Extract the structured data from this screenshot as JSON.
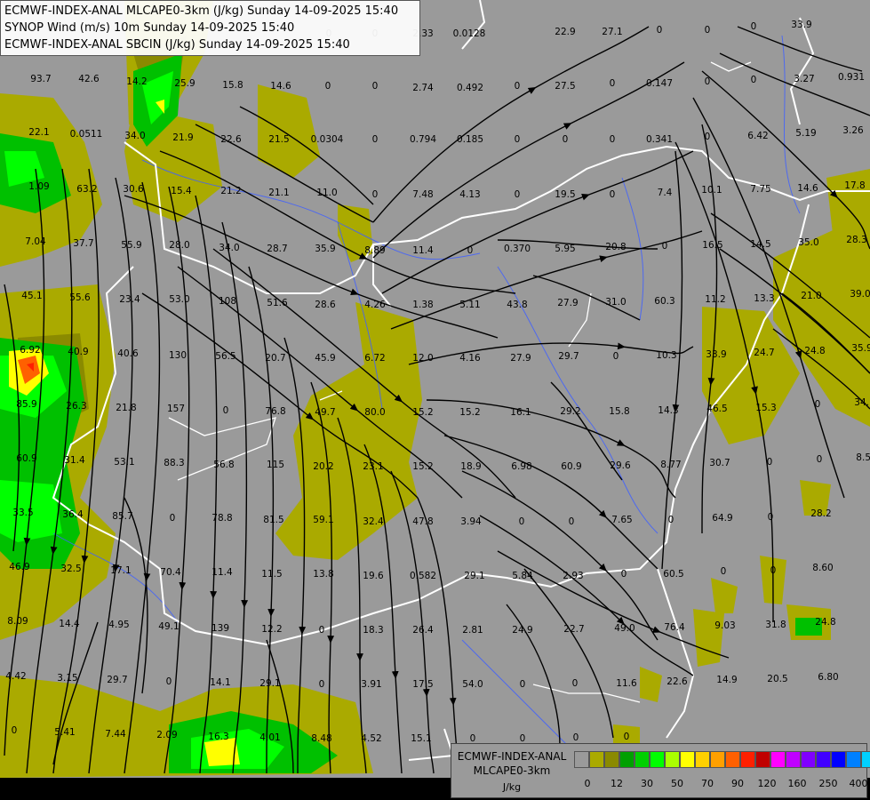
{
  "titles": {
    "line1": "ECMWF-INDEX-ANAL MLCAPE0-3km (J/kg) Sunday 14-09-2025 15:40",
    "line2": "SYNOP Wind (m/s) 10m Sunday 14-09-2025 15:40",
    "line3": "ECMWF-INDEX-ANAL SBCIN (J/kg) Sunday 14-09-2025 15:40"
  },
  "legend": {
    "name_line1": "ECMWF-INDEX-ANAL",
    "name_line2": "MLCAPE0-3km",
    "unit": "J/kg",
    "colors": [
      "#9a9a9a",
      "#aaaa00",
      "#8a8a00",
      "#00a000",
      "#00d000",
      "#00ff00",
      "#aaff00",
      "#ffff00",
      "#ffd000",
      "#ffa000",
      "#ff6000",
      "#ff2000",
      "#c00000",
      "#ff00ff",
      "#c000ff",
      "#8000ff",
      "#4000ff",
      "#0000ff",
      "#0080ff",
      "#00d0ff",
      "#80ffff",
      "#ffffff"
    ],
    "ticks": [
      "0",
      "12",
      "30",
      "50",
      "70",
      "90",
      "120",
      "160",
      "250",
      "400"
    ]
  },
  "values": [
    "0.0128",
    "2.33",
    "0",
    "0",
    "22.9",
    "27.1",
    "0",
    "0",
    "0",
    "33.9",
    "93.7",
    "42.6",
    "14.2",
    "25.9",
    "15.8",
    "14.6",
    "0",
    "0",
    "2.74",
    "0.492",
    "0",
    "27.5",
    "0",
    "0.147",
    "0",
    "0",
    "3.27",
    "0.931",
    "22.1",
    "0.0511",
    "34.0",
    "21.9",
    "22.6",
    "21.5",
    "0.0304",
    "0",
    "0.794",
    "0.185",
    "0",
    "0",
    "0",
    "0.341",
    "0",
    "6.42",
    "5.19",
    "3.26",
    "1.09",
    "63.2",
    "30.6",
    "15.4",
    "21.2",
    "21.1",
    "11.0",
    "0",
    "7.48",
    "4.13",
    "0",
    "19.5",
    "0",
    "7.4",
    "10.1",
    "7.75",
    "14.6",
    "17.8",
    "7.04",
    "37.7",
    "55.9",
    "28.0",
    "34.0",
    "28.7",
    "35.9",
    "8.89",
    "11.4",
    "0",
    "0.370",
    "5.95",
    "20.8",
    "0",
    "16.5",
    "14.5",
    "35.0",
    "28.3",
    "45.1",
    "55.6",
    "23.4",
    "53.0",
    "108",
    "51.6",
    "28.6",
    "4.26",
    "1.38",
    "5.11",
    "43.8",
    "27.9",
    "31.0",
    "60.3",
    "11.2",
    "13.3",
    "21.0",
    "39.0",
    "6.92",
    "40.9",
    "40.6",
    "130",
    "56.5",
    "20.7",
    "45.9",
    "6.72",
    "12.0",
    "4.16",
    "27.9",
    "29.7",
    "0",
    "10.3",
    "33.9",
    "24.7",
    "24.8",
    "35.9",
    "85.9",
    "26.3",
    "21.8",
    "157",
    "0",
    "76.8",
    "49.7",
    "80.0",
    "15.2",
    "15.2",
    "16.1",
    "29.2",
    "15.8",
    "14.3",
    "46.5",
    "15.3",
    "0",
    "34.1",
    "60.9",
    "31.4",
    "53.1",
    "88.3",
    "56.8",
    "115",
    "20.2",
    "23.1",
    "15.2",
    "18.9",
    "6.98",
    "60.9",
    "29.6",
    "8.77",
    "30.7",
    "0",
    "0",
    "8.59",
    "33.5",
    "36.4",
    "85.7",
    "0",
    "78.8",
    "81.5",
    "59.1",
    "32.4",
    "47.8",
    "3.94",
    "0",
    "0",
    "7.65",
    "0",
    "64.9",
    "0",
    "28.2",
    "46.9",
    "32.5",
    "17.1",
    "70.4",
    "11.4",
    "11.5",
    "13.8",
    "19.6",
    "0.582",
    "29.1",
    "5.84",
    "2.93",
    "0",
    "60.5",
    "0",
    "0",
    "8.60",
    "8.09",
    "14.4",
    "4.95",
    "49.1",
    "139",
    "12.2",
    "0",
    "18.3",
    "26.4",
    "2.81",
    "24.9",
    "22.7",
    "49.0",
    "76.4",
    "9.03",
    "31.8",
    "24.8",
    "4.42",
    "3.15",
    "29.7",
    "0",
    "14.1",
    "29.1",
    "0",
    "3.91",
    "17.5",
    "54.0",
    "0",
    "0",
    "11.6",
    "22.6",
    "14.9",
    "20.5",
    "6.80",
    "0",
    "5.41",
    "7.44",
    "2.09",
    "16.3",
    "4.01",
    "8.48",
    "4.52",
    "15.1",
    "0",
    "0",
    "0",
    "0"
  ]
}
